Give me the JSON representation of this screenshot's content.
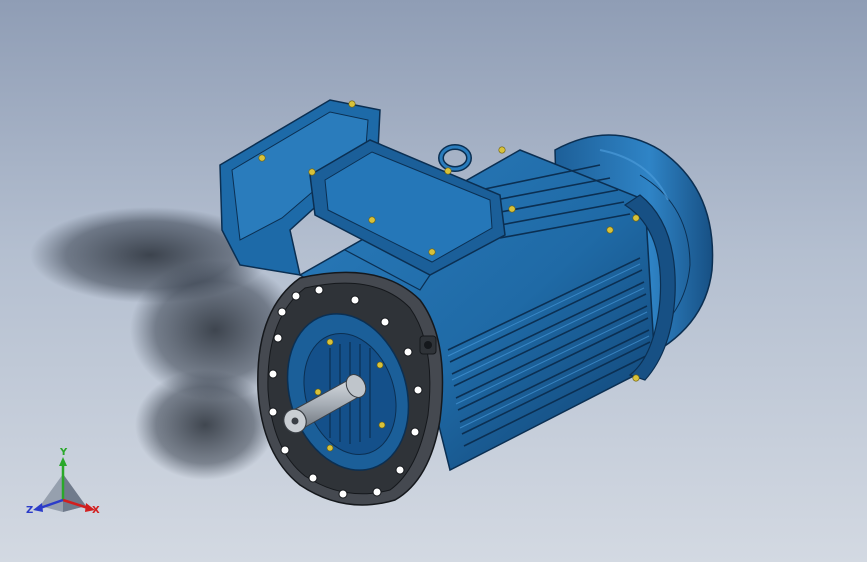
{
  "viewport": {
    "background_top": "#8f9db5",
    "background_bottom": "#d3d9e2",
    "model": {
      "body_color": "#1f6aa6",
      "body_shade": "#0f3f6e",
      "flange_color": "#3c3f44",
      "shaft_color": "#a7aeb6",
      "bolt_color": "#d8c23a"
    }
  },
  "triad": {
    "x_label": "X",
    "y_label": "Y",
    "z_label": "Z",
    "x_color": "#d21f1f",
    "y_color": "#2aa82a",
    "z_color": "#2b3cc9"
  }
}
